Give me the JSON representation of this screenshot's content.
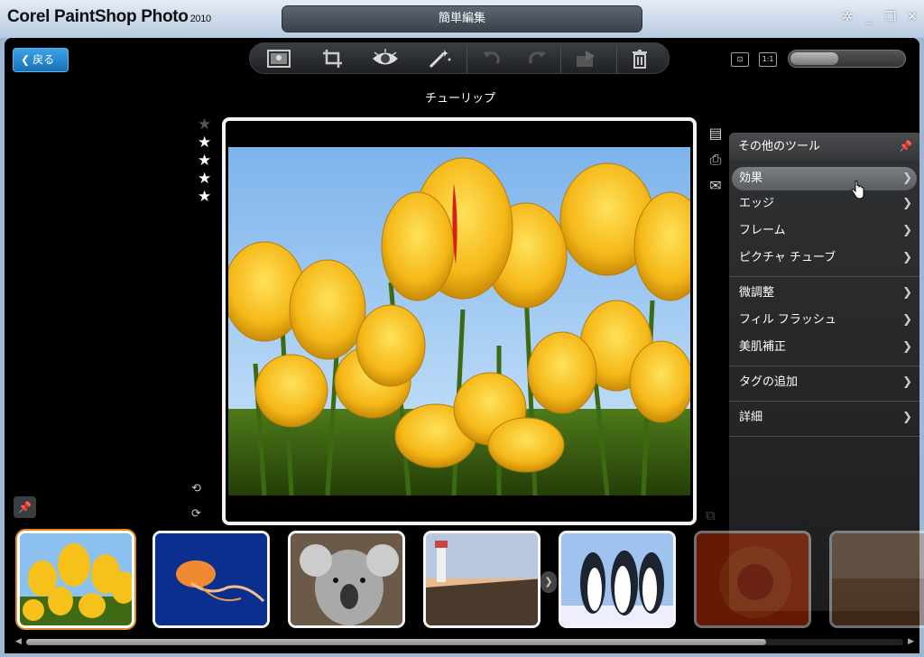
{
  "app": {
    "title": "Corel PaintShop Photo",
    "year": "2010",
    "mode_tab": "簡単編集"
  },
  "window_controls": {
    "settings": "✲",
    "minimize": "_",
    "restore": "❐",
    "close": "✕"
  },
  "back_button": {
    "label": "戻る"
  },
  "photo": {
    "title": "チューリップ",
    "rating": 4,
    "max_rating": 5
  },
  "zoom": {
    "level_fraction": 0.42
  },
  "fit_buttons": {
    "fit": "⊡",
    "actual": "1:1"
  },
  "tools_panel": {
    "title": "その他のツール",
    "groups": [
      {
        "items": [
          "効果",
          "エッジ",
          "フレーム",
          "ピクチャ チューブ"
        ]
      },
      {
        "items": [
          "微調整",
          "フィル フラッシュ",
          "美肌補正"
        ]
      },
      {
        "items": [
          "タグの追加"
        ]
      },
      {
        "items": [
          "詳細"
        ]
      }
    ],
    "highlighted": "効果"
  },
  "thumbnails": [
    {
      "name": "tulips",
      "selected": true
    },
    {
      "name": "jellyfish",
      "selected": false
    },
    {
      "name": "koala",
      "selected": false
    },
    {
      "name": "lighthouse",
      "selected": false
    },
    {
      "name": "penguins",
      "selected": false
    },
    {
      "name": "flower-red",
      "selected": false
    },
    {
      "name": "desert",
      "selected": false
    }
  ],
  "icons": {
    "toolbar": [
      "photo-icon",
      "crop-icon",
      "red-eye-icon",
      "magic-wand-icon",
      "rotate-left-icon",
      "rotate-right-icon",
      "export-icon",
      "trash-icon"
    ],
    "side": [
      "save-icon",
      "print-icon",
      "email-icon"
    ]
  },
  "colors": {
    "accent_blue": "#1a6fb4",
    "selection_orange": "#e08a1e",
    "panel_bg": "#2f3133"
  }
}
